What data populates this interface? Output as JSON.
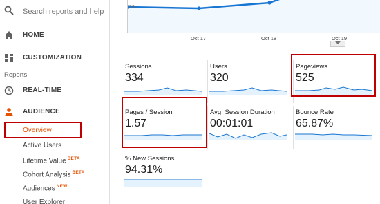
{
  "sidebar": {
    "search_placeholder": "Search reports and help",
    "home_label": "HOME",
    "customization_label": "CUSTOMIZATION",
    "reports_header": "Reports",
    "realtime_label": "REAL-TIME",
    "audience_label": "AUDIENCE",
    "sub_items": [
      {
        "label": "Overview",
        "badge": ""
      },
      {
        "label": "Active Users",
        "badge": ""
      },
      {
        "label": "Lifetime Value",
        "badge": "BETA"
      },
      {
        "label": "Cohort Analysis",
        "badge": "BETA"
      },
      {
        "label": "Audiences",
        "badge": "NEW"
      },
      {
        "label": "User Explorer",
        "badge": ""
      }
    ]
  },
  "chart": {
    "y_tick": "50",
    "x_ticks": [
      "Oct 17",
      "Oct 18",
      "Oct 19"
    ]
  },
  "metrics": [
    {
      "label": "Sessions",
      "value": "334"
    },
    {
      "label": "Users",
      "value": "320"
    },
    {
      "label": "Pageviews",
      "value": "525"
    },
    {
      "label": "Pages / Session",
      "value": "1.57"
    },
    {
      "label": "Avg. Session Duration",
      "value": "00:01:01"
    },
    {
      "label": "Bounce Rate",
      "value": "65.87%"
    },
    {
      "label": "% New Sessions",
      "value": "94.31%"
    }
  ],
  "colors": {
    "accent_orange": "#e65100",
    "highlight_red": "#c00000",
    "line_blue": "#1976d2",
    "fill_blue": "#e3f2fd"
  },
  "icons": {
    "search": "search-icon",
    "home": "home-icon",
    "customization": "dashboard-icon",
    "realtime": "clock-icon",
    "audience": "person-icon"
  }
}
